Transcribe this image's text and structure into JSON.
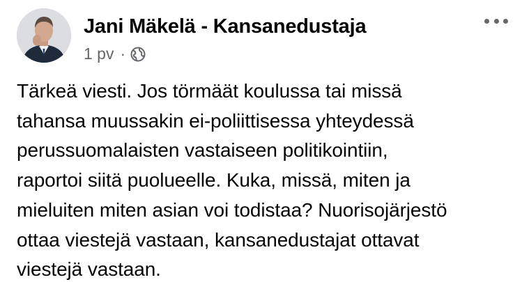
{
  "post": {
    "author": "Jani Mäkelä - Kansanedustaja",
    "timestamp": "1 pv",
    "separator": "·",
    "privacy_icon": "globe-icon",
    "more_icon": "more-options-icon",
    "text": "Tärkeä viesti. Jos törmäät koulussa tai missä\ntahansa muussakin ei-poliittisessa yhteydessä\nperussuomalaisten vastaiseen politikointiin,\nraportoi siitä puolueelle. Kuka, missä, miten ja\nmieluiten miten asian voi todistaa? Nuorisojärjestö\nottaa viestejä vastaan, kansanedustajat ottavat\nviestejä vastaan."
  },
  "colors": {
    "text": "#050505",
    "secondary_text": "#65676b",
    "background": "#ffffff"
  }
}
